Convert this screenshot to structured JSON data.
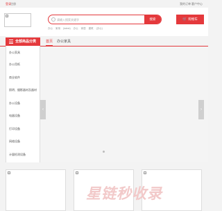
{
  "topbar": {
    "login": "登录",
    "register": "注册",
    "orders": "我的订单",
    "service": "客户中心"
  },
  "header": {
    "search": {
      "placeholder": "请输入搜索关键字",
      "button": "搜索"
    },
    "hot_words": [
      "办公",
      "家用",
      "(latest)",
      "办公",
      "家居",
      "建筑",
      "(办公)"
    ],
    "cart_label": "购物车"
  },
  "categories": {
    "title": "全部商品分类",
    "items": [
      "办公家具",
      "办公用纸",
      "商业软件",
      "照明、摄影器材及器材",
      "办公设备",
      "电器设备",
      "打印设备",
      "网络设备",
      "计量检测设备"
    ]
  },
  "nav": {
    "tabs": [
      "首页",
      "办公家具"
    ]
  },
  "watermark": "星链秒收录",
  "colors": {
    "accent": "#e4393c"
  }
}
